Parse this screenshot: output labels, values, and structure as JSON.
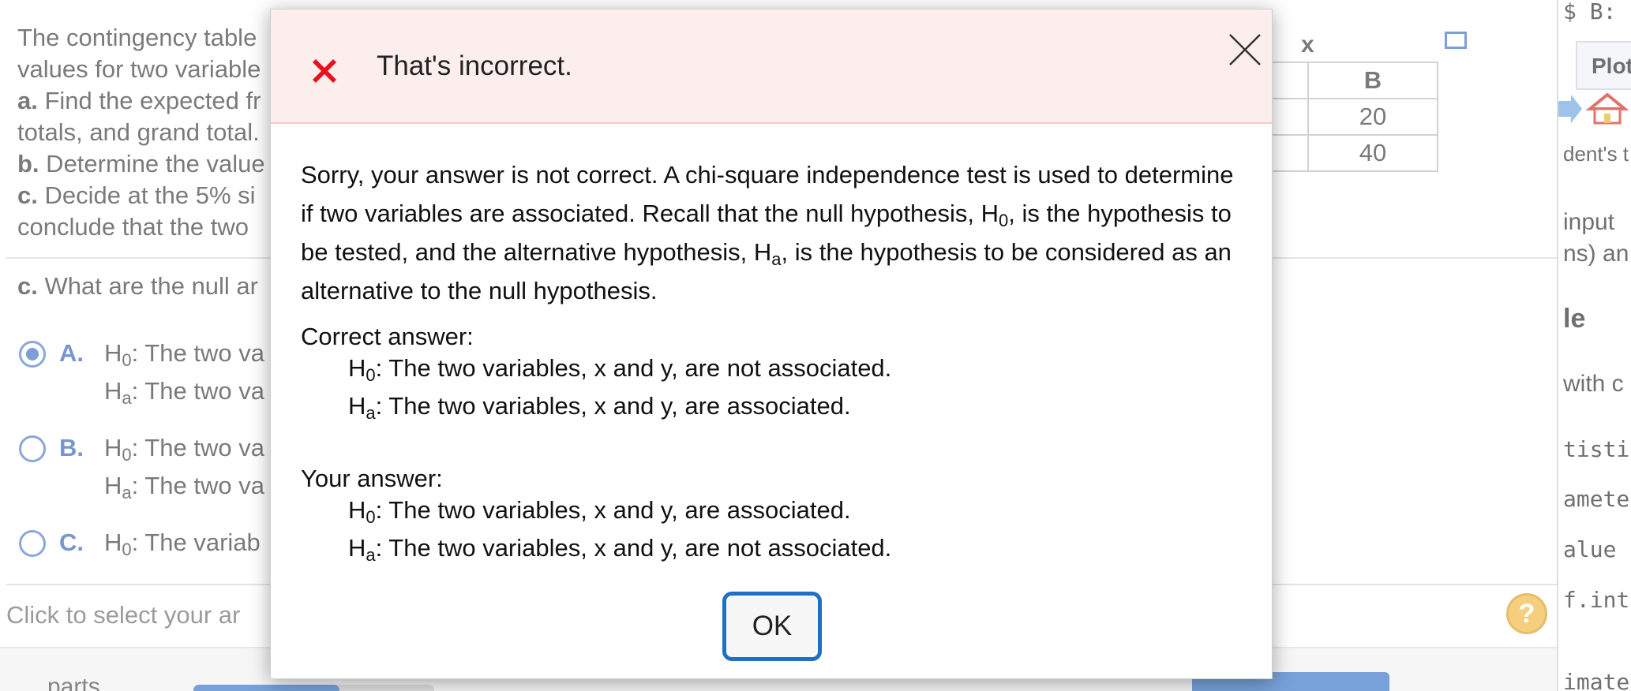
{
  "question": {
    "intro_1": "The contingency table",
    "intro_2": "values for two variable",
    "a_label": "a.",
    "a_text": " Find the expected fr",
    "a_text_2": "totals, and grand total.",
    "b_label": "b.",
    "b_text": " Determine the value",
    "c_label": "c.",
    "c_text": " Decide at the 5% si",
    "c_text_2": "conclude that the two",
    "c_question_label": "c.",
    "c_question": " What are the null ar",
    "click_prompt": "Click to select your ar",
    "table_header_x": "x",
    "table_col_b": "B",
    "table_values": [
      "20",
      "40"
    ]
  },
  "options": [
    {
      "letter": "A.",
      "h0": ": The two va",
      "ha": ": The two va",
      "selected": true
    },
    {
      "letter": "B.",
      "h0": ": The two va",
      "ha": ": The two va",
      "selected": false
    },
    {
      "letter": "C.",
      "h0": ": The variab",
      "selected": false
    }
  ],
  "footer": {
    "parts_text": "parts",
    "help_label": "?",
    "progress_fraction": 0.6
  },
  "right_panel": {
    "top_code": "$ B: ",
    "plots_tab": "Plot",
    "line_1": "dent's t",
    "line_2": "input",
    "line_3": "ns) an",
    "line_4": "le",
    "line_5": "with c",
    "line_6": "tisti",
    "line_7": "amete",
    "line_8": "alue",
    "line_9": "f.int",
    "line_10": "imate"
  },
  "modal": {
    "title": "That's incorrect.",
    "explanation_1": "Sorry, your answer is not correct. A chi-square independence test is used to determine if two variables are associated. Recall that the null hypothesis, H",
    "explanation_sub_0": "0",
    "explanation_2": ", is the hypothesis to be tested, and the alternative hypothesis, H",
    "explanation_sub_a": "a",
    "explanation_3": ", is the hypothesis to be considered as an alternative to the null hypothesis.",
    "correct_label": "Correct answer:",
    "correct_h0": ": The two variables, x and y, are not associated.",
    "correct_ha": ": The two variables, x and y, are associated.",
    "your_label": "Your answer:",
    "your_h0": ": The two variables, x and y, are associated.",
    "your_ha": ": The two variables, x and y, are not associated.",
    "h_letter": "H",
    "sub_0": "0",
    "sub_a": "a",
    "ok_label": "OK"
  },
  "colors": {
    "error_red": "#e8101e",
    "header_bg": "#fdeeee",
    "ok_border": "#1f6fc4",
    "radio_blue": "#3a6bc6"
  }
}
